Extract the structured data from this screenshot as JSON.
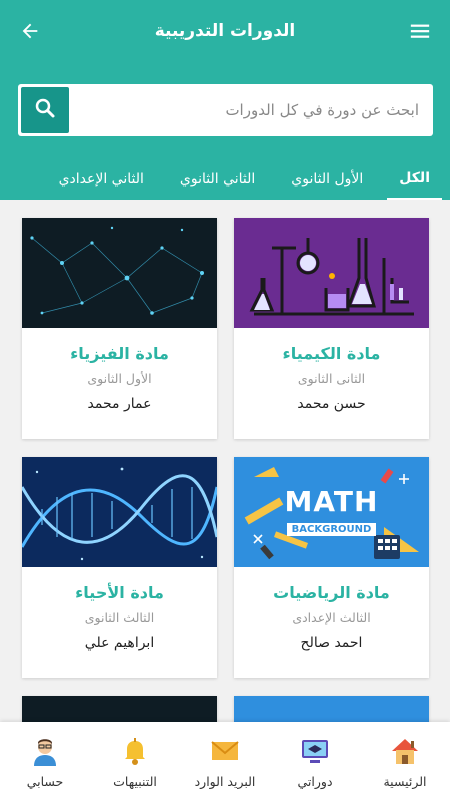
{
  "app_bar": {
    "title": "الدورات التدريبية"
  },
  "search": {
    "placeholder": "ابحث عن دورة في كل الدورات"
  },
  "tabs": [
    {
      "label": "الكل",
      "active": true
    },
    {
      "label": "الأول الثانوي",
      "active": false
    },
    {
      "label": "الثاني الثانوي",
      "active": false
    },
    {
      "label": "الثاني الإعدادي",
      "active": false
    }
  ],
  "courses": [
    {
      "title": "مادة الكيمياء",
      "grade": "الثانى الثانوى",
      "teacher": "حسن محمد",
      "image_icon": "chemistry-lab-image"
    },
    {
      "title": "مادة الفيزياء",
      "grade": "الأول الثانوى",
      "teacher": "عمار محمد",
      "image_icon": "network-particles-image"
    },
    {
      "title": "مادة الرياضيات",
      "grade": "الثالث الإعدادى",
      "teacher": "احمد صالح",
      "image_icon": "math-background-image",
      "image_text_1": "MATH",
      "image_text_2": "BACKGROUND"
    },
    {
      "title": "مادة الأحياء",
      "grade": "الثالث الثانوى",
      "teacher": "ابراهيم علي",
      "image_icon": "dna-helix-image"
    }
  ],
  "bottom_nav": [
    {
      "label": "الرئيسية",
      "icon": "home-icon"
    },
    {
      "label": "دوراتي",
      "icon": "my-courses-icon"
    },
    {
      "label": "البريد الوارد",
      "icon": "mail-icon"
    },
    {
      "label": "التنبيهات",
      "icon": "bell-icon"
    },
    {
      "label": "حسابي",
      "icon": "account-icon"
    }
  ],
  "colors": {
    "primary": "#2bb3a3",
    "primary_dark": "#17958a",
    "chemistry_bg": "#6a2c91",
    "math_bg": "#2f8fde",
    "dna_bg": "#0c2a5e",
    "physics_bg": "#0e1c24"
  }
}
